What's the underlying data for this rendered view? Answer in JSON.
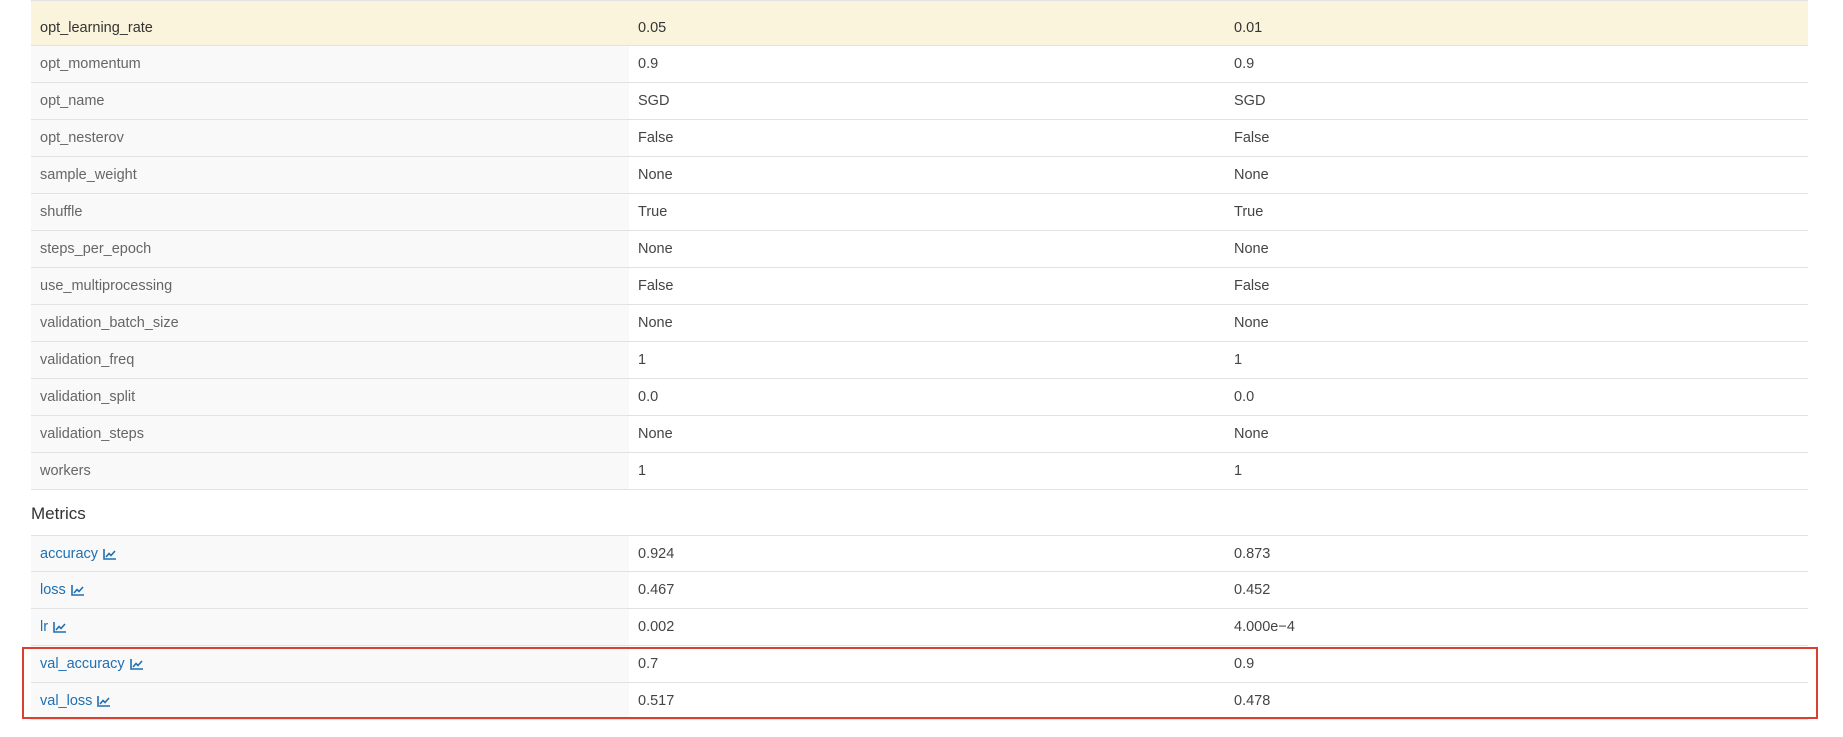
{
  "parameters": [
    {
      "name": "opt_learning_rate",
      "run1": "0.05",
      "run2": "0.01",
      "highlighted": true
    },
    {
      "name": "opt_momentum",
      "run1": "0.9",
      "run2": "0.9"
    },
    {
      "name": "opt_name",
      "run1": "SGD",
      "run2": "SGD"
    },
    {
      "name": "opt_nesterov",
      "run1": "False",
      "run2": "False"
    },
    {
      "name": "sample_weight",
      "run1": "None",
      "run2": "None"
    },
    {
      "name": "shuffle",
      "run1": "True",
      "run2": "True"
    },
    {
      "name": "steps_per_epoch",
      "run1": "None",
      "run2": "None"
    },
    {
      "name": "use_multiprocessing",
      "run1": "False",
      "run2": "False"
    },
    {
      "name": "validation_batch_size",
      "run1": "None",
      "run2": "None"
    },
    {
      "name": "validation_freq",
      "run1": "1",
      "run2": "1"
    },
    {
      "name": "validation_split",
      "run1": "0.0",
      "run2": "0.0"
    },
    {
      "name": "validation_steps",
      "run1": "None",
      "run2": "None"
    },
    {
      "name": "workers",
      "run1": "1",
      "run2": "1"
    }
  ],
  "metrics_section": {
    "title": "Metrics",
    "rows": [
      {
        "name": "accuracy",
        "run1": "0.924",
        "run2": "0.873",
        "icon": "line-chart-icon"
      },
      {
        "name": "loss",
        "run1": "0.467",
        "run2": "0.452",
        "icon": "line-chart-icon"
      },
      {
        "name": "lr",
        "run1": "0.002",
        "run2": "4.000e−4",
        "icon": "line-chart-icon"
      },
      {
        "name": "val_accuracy",
        "run1": "0.7",
        "run2": "0.9",
        "icon": "line-chart-icon"
      },
      {
        "name": "val_loss",
        "run1": "0.517",
        "run2": "0.478",
        "icon": "line-chart-icon"
      }
    ]
  },
  "colors": {
    "link": "#1f6fb2",
    "highlight_row": "#fbf4dc",
    "annotation_box": "#d9402f"
  }
}
